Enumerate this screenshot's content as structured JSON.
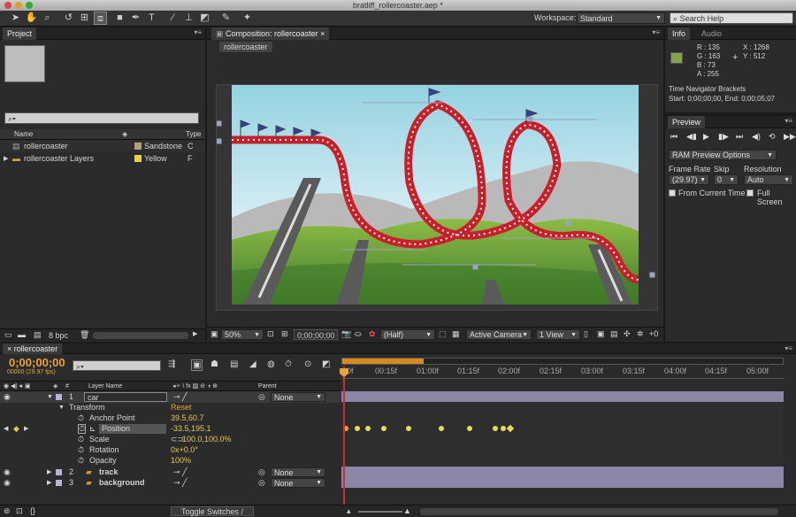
{
  "window_title": "bratliff_rollercoaster.aep *",
  "toolbar": {
    "workspace_label": "Workspace:",
    "workspace_value": "Standard",
    "search_help_placeholder": "Search Help"
  },
  "project": {
    "tab": "Project",
    "columns": {
      "name": "Name",
      "type": "Type"
    },
    "items": [
      {
        "name": "rollercoaster",
        "label": "Sandstone",
        "label_color": "#b7a07a",
        "type": "C"
      },
      {
        "name": "rollercoaster Layers",
        "label": "Yellow",
        "label_color": "#e6d24a",
        "type": "F"
      }
    ],
    "bpc": "8 bpc"
  },
  "composition": {
    "tab": "Composition: rollercoaster",
    "subtab": "rollercoaster",
    "zoom": "50%",
    "timecode": "0;00;00;00",
    "resolution": "(Half)",
    "camera": "Active Camera",
    "view": "1 View",
    "offset_suffix": "+0"
  },
  "info": {
    "tab": "Info",
    "audio_tab": "Audio",
    "r": "R : 135",
    "g": "G : 163",
    "b": "B : 73",
    "a": "A : 255",
    "x": "X : 1268",
    "y": "Y : 512",
    "swatch_color": "#87a349",
    "nav_title": "Time Navigator Brackets",
    "nav_range": "Start: 0;00;00;00, End: 0;00;05;07"
  },
  "preview": {
    "tab": "Preview",
    "ram_options": "RAM Preview Options",
    "frame_rate_label": "Frame Rate",
    "skip_label": "Skip",
    "resolution_label": "Resolution",
    "frame_rate_value": "(29.97)",
    "skip_value": "0",
    "resolution_value": "Auto",
    "from_current_time": "From Current Time",
    "full_screen": "Full Screen"
  },
  "timeline": {
    "tab": "rollercoaster",
    "timecode": "0;00;00;00",
    "fps": "00000 (29.97 fps)",
    "col_layer_name": "Layer Name",
    "col_parent": "Parent",
    "ruler": [
      "0f",
      "00:15f",
      "01:00f",
      "01:15f",
      "02:00f",
      "02:15f",
      "03:00f",
      "03:15f",
      "04:00f",
      "04:15f",
      "05:00f"
    ],
    "layers": [
      {
        "index": "1",
        "name": "car",
        "parent": "None"
      },
      {
        "index": "2",
        "name": "track",
        "parent": "None"
      },
      {
        "index": "3",
        "name": "background",
        "parent": "None"
      }
    ],
    "transform": {
      "label": "Transform",
      "reset": "Reset",
      "anchor_label": "Anchor Point",
      "anchor_value": "39.5,60.7",
      "position_label": "Position",
      "position_value": "-33.5,195.1",
      "scale_label": "Scale",
      "scale_value": "100.0,100.0%",
      "rotation_label": "Rotation",
      "rotation_value": "0x+0.0°",
      "opacity_label": "Opacity",
      "opacity_value": "100%"
    },
    "toggle_label": "Toggle Switches / Modes"
  }
}
